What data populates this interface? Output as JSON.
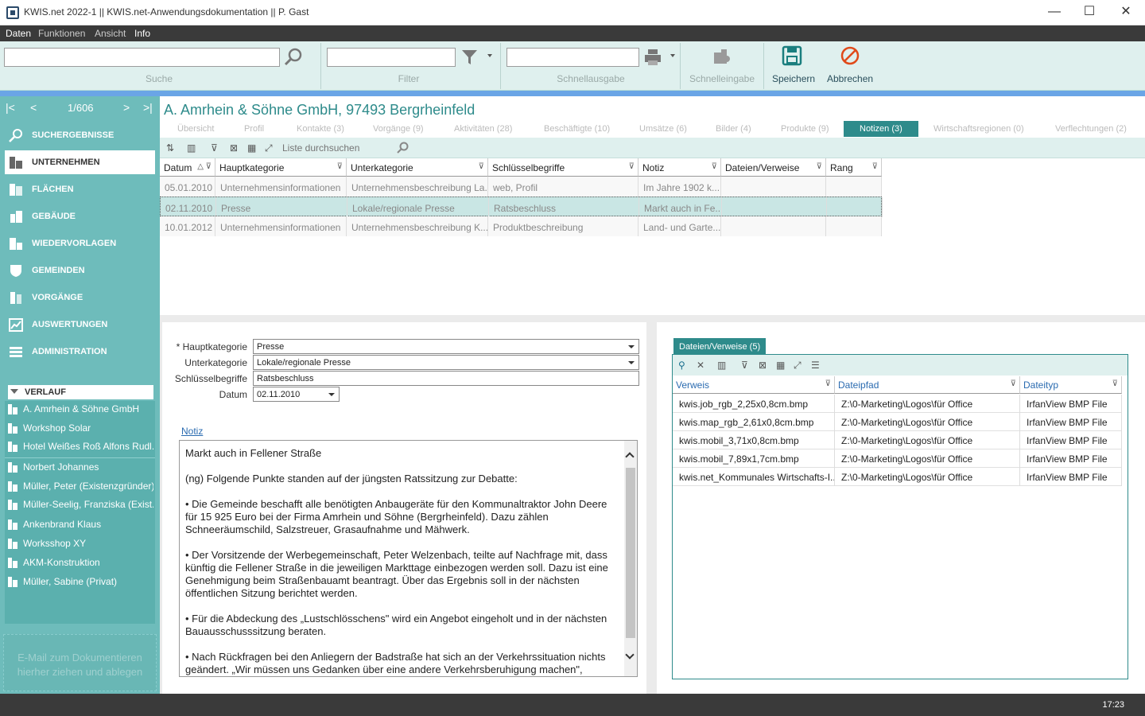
{
  "window": {
    "title": "KWIS.net 2022-1 || KWIS.net-Anwendungsdokumentation || P. Gast",
    "minimize": "—",
    "maximize": "☐",
    "close": "✕"
  },
  "menu": [
    "Daten",
    "Funktionen",
    "Ansicht",
    "Info"
  ],
  "toolbar": {
    "search_label": "Suche",
    "filter_label": "Filter",
    "quickout_label": "Schnellausgabe",
    "quickentry_label": "Schnelleingabe",
    "save_label": "Speichern",
    "cancel_label": "Abbrechen",
    "search_value": "",
    "filter_value": "",
    "quickout_value": ""
  },
  "nav": {
    "first": "|<",
    "prev": "<",
    "position": "1/606",
    "next": ">",
    "last": ">|",
    "items": [
      {
        "label": "SUCHERGEBNISSE",
        "icon": "search-icon"
      },
      {
        "label": "UNTERNEHMEN",
        "icon": "building-icon"
      },
      {
        "label": "FLÄCHEN",
        "icon": "area-icon"
      },
      {
        "label": "GEBÄUDE",
        "icon": "building-icon"
      },
      {
        "label": "WIEDERVORLAGEN",
        "icon": "reminder-icon"
      },
      {
        "label": "GEMEINDEN",
        "icon": "shield-icon"
      },
      {
        "label": "VORGÄNGE",
        "icon": "process-icon"
      },
      {
        "label": "AUSWERTUNGEN",
        "icon": "chart-icon"
      },
      {
        "label": "ADMINISTRATION",
        "icon": "admin-icon"
      }
    ]
  },
  "verlauf": {
    "title": "VERLAUF",
    "items": [
      "A. Amrhein & Söhne GmbH",
      "Workshop Solar",
      "Hotel Weißes Roß Alfons Rudl...",
      "Norbert Johannes",
      "Müller, Peter (Existenzgründer)",
      "Müller-Seelig, Franziska (Exist...",
      "Ankenbrand Klaus",
      "Worksshop XY",
      "AKM-Konstruktion",
      "Müller, Sabine (Privat)"
    ]
  },
  "dropzone": "E-Mail zum Dokumentieren hierher ziehen und ablegen",
  "record": {
    "title": "A. Amrhein & Söhne GmbH, 97493 Bergrheinfeld"
  },
  "tabs": [
    {
      "label": "Übersicht"
    },
    {
      "label": "Profil"
    },
    {
      "label": "Kontakte (3)"
    },
    {
      "label": "Vorgänge (9)"
    },
    {
      "label": "Aktivitäten (28)"
    },
    {
      "label": "Beschäftigte (10)"
    },
    {
      "label": "Umsätze (6)"
    },
    {
      "label": "Bilder (4)"
    },
    {
      "label": "Produkte (9)"
    },
    {
      "label": "Notizen (3)"
    },
    {
      "label": "Wirtschaftsregionen (0)"
    },
    {
      "label": "Verflechtungen (2)"
    }
  ],
  "grid": {
    "search_placeholder": "Liste durchsuchen",
    "columns": [
      "Datum",
      "Hauptkategorie",
      "Unterkategorie",
      "Schlüsselbegriffe",
      "Notiz",
      "Dateien/Verweise",
      "Rang"
    ],
    "rows": [
      [
        "05.01.2010",
        "Unternehmensinformationen",
        "Unternehmensbeschreibung  La...",
        "web, Profil",
        "Im Jahre 1902 k...",
        "",
        ""
      ],
      [
        "02.11.2010",
        "Presse",
        "Lokale/regionale Presse",
        "Ratsbeschluss",
        "Markt auch in Fe...",
        "",
        ""
      ],
      [
        "10.01.2012",
        "Unternehmensinformationen",
        "Unternehmensbeschreibung  K...",
        "Produktbeschreibung",
        "Land- und Garte...",
        "",
        ""
      ]
    ]
  },
  "form": {
    "hauptkategorie_label": "* Hauptkategorie",
    "hauptkategorie_value": "Presse",
    "unterkategorie_label": "Unterkategorie",
    "unterkategorie_value": "Lokale/regionale Presse",
    "schluessel_label": "Schlüsselbegriffe",
    "schluessel_value": "Ratsbeschluss",
    "datum_label": "Datum",
    "datum_value": "02.11.2010",
    "notiz_label": "Notiz",
    "notiz_text": "Markt auch in Fellener Straße\n\n(ng) Folgende Punkte standen auf der jüngsten Ratssitzung zur Debatte:\n\n• Die Gemeinde beschafft alle benötigten Anbaugeräte für den Kommunaltraktor John Deere für 15 925 Euro bei der Firma Amrhein und Söhne (Bergrheinfeld). Dazu zählen Schneeräumschild, Salzstreuer, Grasaufnahme und Mähwerk.\n\n• Der Vorsitzende der Werbegemeinschaft, Peter Welzenbach, teilte auf Nachfrage mit, dass künftig die Fellener Straße in die jeweiligen Markttage einbezogen werden soll. Dazu ist eine Genehmigung beim Straßenbauamt beantragt. Über das Ergebnis soll in der nächsten öffentlichen Sitzung berichtet werden.\n\n• Für die Abdeckung des „Lustschlösschens\" wird ein Angebot eingeholt und in der nächsten Bauausschusssitzung beraten.\n\n• Nach Rückfragen bei den Anliegern der Badstraße hat sich an der Verkehrssituation nichts geändert. „Wir müssen uns Gedanken über eine andere Verkehrsberuhigung machen\","
  },
  "files": {
    "tab_label": "Dateien/Verweise (5)",
    "columns": [
      "Verweis",
      "Dateipfad",
      "Dateityp"
    ],
    "rows": [
      [
        "kwis.job_rgb_2,25x0,8cm.bmp",
        "Z:\\0-Marketing\\Logos\\für Office",
        "IrfanView BMP File"
      ],
      [
        "kwis.map_rgb_2,61x0,8cm.bmp",
        "Z:\\0-Marketing\\Logos\\für Office",
        "IrfanView BMP File"
      ],
      [
        "kwis.mobil_3,71x0,8cm.bmp",
        "Z:\\0-Marketing\\Logos\\für Office",
        "IrfanView BMP File"
      ],
      [
        "kwis.mobil_7,89x1,7cm.bmp",
        "Z:\\0-Marketing\\Logos\\für Office",
        "IrfanView BMP File"
      ],
      [
        "kwis.net_Kommunales  Wirtschafts-I...",
        "Z:\\0-Marketing\\Logos\\für Office",
        "IrfanView BMP File"
      ]
    ]
  },
  "status": {
    "time": "17:23"
  }
}
